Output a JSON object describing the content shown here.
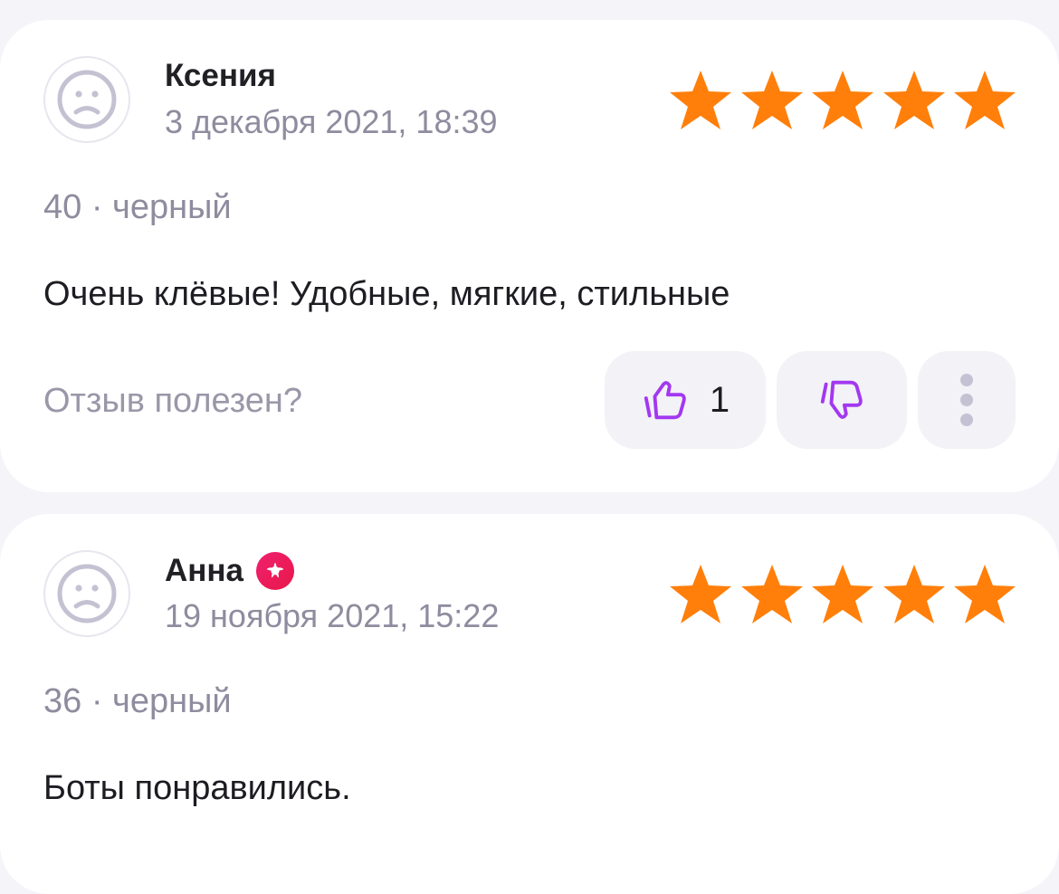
{
  "colors": {
    "star": "#ff7f0a",
    "accent": "#a338f0",
    "muted_text": "#8e8c9e",
    "badge": "#ea1d5c"
  },
  "reviews": [
    {
      "author": "Ксения",
      "date": "3 декабря 2021, 18:39",
      "rating": 5,
      "meta": "40 · черный",
      "text": "Очень клёвые! Удобные, мягкие, стильные",
      "helpful_label": "Отзыв полезен?",
      "likes": "1",
      "icons": [
        "avatar-icon",
        "star-icon",
        "thumbs-up-icon",
        "thumbs-down-icon",
        "more-vertical-icon"
      ]
    },
    {
      "author": "Анна",
      "date": "19 ноября 2021, 15:22",
      "rating": 5,
      "meta": "36 · черный",
      "text": "Боты понравились.",
      "icons": [
        "avatar-icon",
        "verified-badge-icon",
        "star-icon"
      ]
    }
  ]
}
